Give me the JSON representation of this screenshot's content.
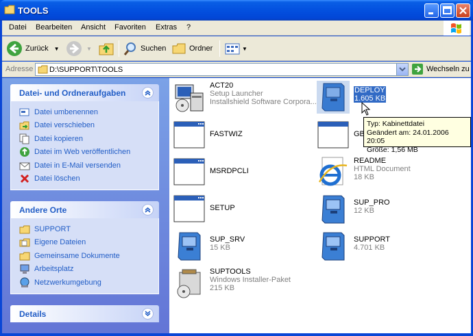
{
  "window": {
    "title": "TOOLS"
  },
  "menu": [
    "Datei",
    "Bearbeiten",
    "Ansicht",
    "Favoriten",
    "Extras",
    "?"
  ],
  "toolbar": {
    "back": "Zurück",
    "search": "Suchen",
    "folders": "Ordner"
  },
  "address": {
    "label": "Adresse",
    "path": "D:\\SUPPORT\\TOOLS",
    "go": "Wechseln zu"
  },
  "file_tasks": {
    "title": "Datei- und Ordneraufgaben",
    "items": [
      {
        "label": "Datei umbenennen",
        "icon": "rename-icon"
      },
      {
        "label": "Datei verschieben",
        "icon": "move-icon"
      },
      {
        "label": "Datei kopieren",
        "icon": "copy-icon"
      },
      {
        "label": "Datei im Web veröffentlichen",
        "icon": "publish-web-icon"
      },
      {
        "label": "Datei in E-Mail versenden",
        "icon": "email-icon"
      },
      {
        "label": "Datei löschen",
        "icon": "delete-icon"
      }
    ]
  },
  "other_places": {
    "title": "Andere Orte",
    "items": [
      {
        "label": "SUPPORT",
        "icon": "folder-icon"
      },
      {
        "label": "Eigene Dateien",
        "icon": "my-documents-icon"
      },
      {
        "label": "Gemeinsame Dokumente",
        "icon": "shared-documents-icon"
      },
      {
        "label": "Arbeitsplatz",
        "icon": "my-computer-icon"
      },
      {
        "label": "Netzwerkumgebung",
        "icon": "network-icon"
      }
    ]
  },
  "details": {
    "title": "Details"
  },
  "files": [
    {
      "name": "ACT20",
      "line2": "Setup Launcher",
      "line3": "Installshield Software Corpora...",
      "icon": "installer-icon"
    },
    {
      "name": "DEPLOY",
      "line2": "1.605 KB",
      "line3": "",
      "icon": "cabinet-icon",
      "selected": true
    },
    {
      "name": "FASTWIZ",
      "line2": "",
      "line3": "",
      "icon": "application-window-icon"
    },
    {
      "name": "GBU",
      "line2": "",
      "line3": "",
      "icon": "application-window-icon"
    },
    {
      "name": "MSRDPCLI",
      "line2": "",
      "line3": "",
      "icon": "application-window-icon"
    },
    {
      "name": "README",
      "line2": "HTML Document",
      "line3": "18 KB",
      "icon": "internet-explorer-icon"
    },
    {
      "name": "SETUP",
      "line2": "",
      "line3": "",
      "icon": "application-window-icon"
    },
    {
      "name": "SUP_PRO",
      "line2": "12 KB",
      "line3": "",
      "icon": "cabinet-icon"
    },
    {
      "name": "SUP_SRV",
      "line2": "15 KB",
      "line3": "",
      "icon": "cabinet-icon"
    },
    {
      "name": "SUPPORT",
      "line2": "4.701 KB",
      "line3": "",
      "icon": "cabinet-icon"
    },
    {
      "name": "SUPTOOLS",
      "line2": "Windows Installer-Paket",
      "line3": "215 KB",
      "icon": "msi-package-icon"
    }
  ],
  "tooltip": {
    "type": "Typ: Kabinettdatei",
    "changed": "Geändert am: 24.01.2006 20:05",
    "size": "Größe: 1,56 MB"
  }
}
